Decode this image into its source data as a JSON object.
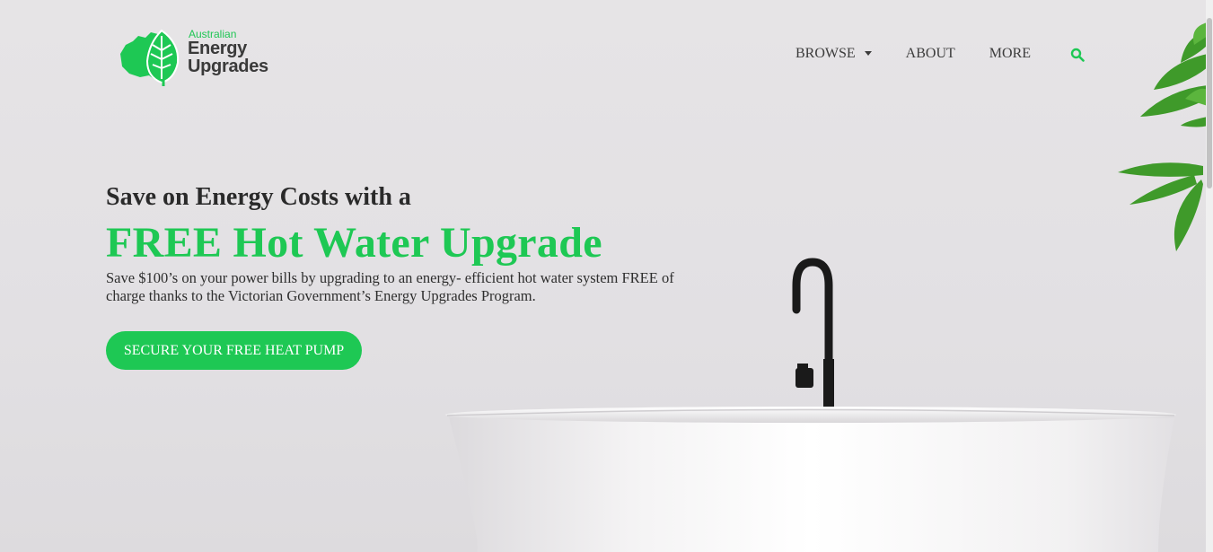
{
  "brand": {
    "line1": "Australian",
    "line2": "Energy",
    "line3": "Upgrades"
  },
  "nav": {
    "items": [
      {
        "label": "BROWSE",
        "has_dropdown": true
      },
      {
        "label": "ABOUT"
      },
      {
        "label": "MORE"
      }
    ],
    "search_icon": "search-icon"
  },
  "hero": {
    "title_line1": "Save on Energy Costs with a",
    "title_line2": "FREE Hot Water Upgrade",
    "description": "Save $100’s on your power bills by upgrading to an energy- efficient hot water system FREE of charge thanks to the Victorian Government’s Energy Upgrades Program.",
    "cta_label": "SECURE YOUR FREE HEAT PUMP"
  },
  "colors": {
    "accent": "#1ec854",
    "text_dark": "#2a2a2a",
    "background": "#e4e2e5"
  }
}
